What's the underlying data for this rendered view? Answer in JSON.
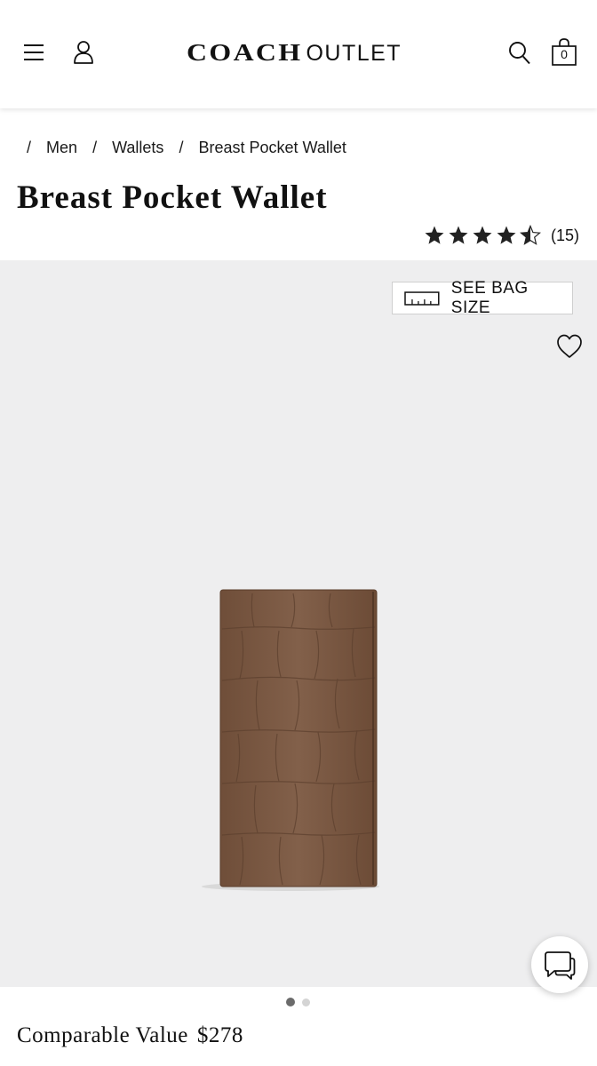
{
  "header": {
    "brand": "COACH",
    "brand_suffix": "OUTLET",
    "bag_count": "0",
    "icons": [
      "menu-icon",
      "account-icon",
      "search-icon",
      "shopping-bag-icon"
    ]
  },
  "breadcrumb": {
    "separator": "/",
    "items": [
      "Men",
      "Wallets",
      "Breast Pocket Wallet"
    ]
  },
  "product": {
    "title": "Breast Pocket Wallet",
    "rating": 4.5,
    "rating_max": 5,
    "review_count": "(15)",
    "comparable_label": "Comparable Value",
    "comparable_price": "$278"
  },
  "gallery": {
    "bag_size_label": "SEE BAG SIZE",
    "image_count": 2,
    "active_image": 1,
    "wallet_color": "#7d5a43",
    "background_color": "#eeeeef"
  },
  "colors": {
    "text": "#111111",
    "gallery_bg": "#eeeeef",
    "dot_active": "#6b6b6b",
    "dot_inactive": "#d4d4d4"
  }
}
